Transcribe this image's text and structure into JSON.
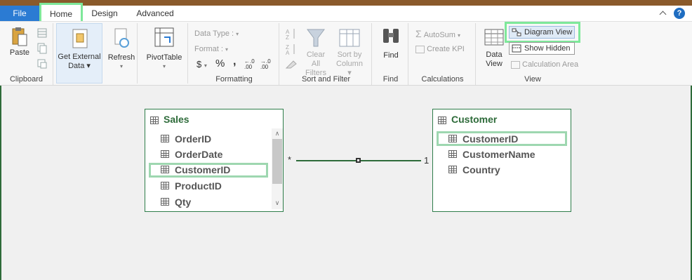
{
  "tabs": {
    "file": "File",
    "home": "Home",
    "design": "Design",
    "advanced": "Advanced"
  },
  "ribbon": {
    "clipboard": {
      "paste": "Paste",
      "label": "Clipboard"
    },
    "get_external_data": {
      "line1": "Get External",
      "line2": "Data"
    },
    "refresh": "Refresh",
    "pivottable": "PivotTable",
    "formatting": {
      "data_type": "Data Type :",
      "format": "Format :",
      "currency": "$",
      "percent": "%",
      "comma": ",",
      "inc_decimal": "←.0 .00",
      "dec_decimal": "→.0 .00",
      "label": "Formatting"
    },
    "sort_filter": {
      "clear_line1": "Clear All",
      "clear_line2": "Filters",
      "sort_line1": "Sort by",
      "sort_line2": "Column",
      "label": "Sort and Filter"
    },
    "find": {
      "button": "Find",
      "label": "Find"
    },
    "calculations": {
      "autosum": "AutoSum",
      "create_kpi": "Create KPI",
      "label": "Calculations"
    },
    "view": {
      "data_view_line1": "Data",
      "data_view_line2": "View",
      "diagram_view": "Diagram View",
      "show_hidden": "Show Hidden",
      "calculation_area": "Calculation Area",
      "label": "View"
    }
  },
  "diagram": {
    "sales": {
      "title": "Sales",
      "fields": [
        "OrderID",
        "OrderDate",
        "CustomerID",
        "ProductID",
        "Qty"
      ]
    },
    "customer": {
      "title": "Customer",
      "fields": [
        "CustomerID",
        "CustomerName",
        "Country"
      ]
    },
    "relationship": {
      "many": "*",
      "one": "1"
    }
  },
  "colors": {
    "accent_file_tab": "#2b7bd3",
    "highlight": "#7ee89a",
    "table_border": "#2e7d4a",
    "table_title": "#2e6b3a"
  }
}
